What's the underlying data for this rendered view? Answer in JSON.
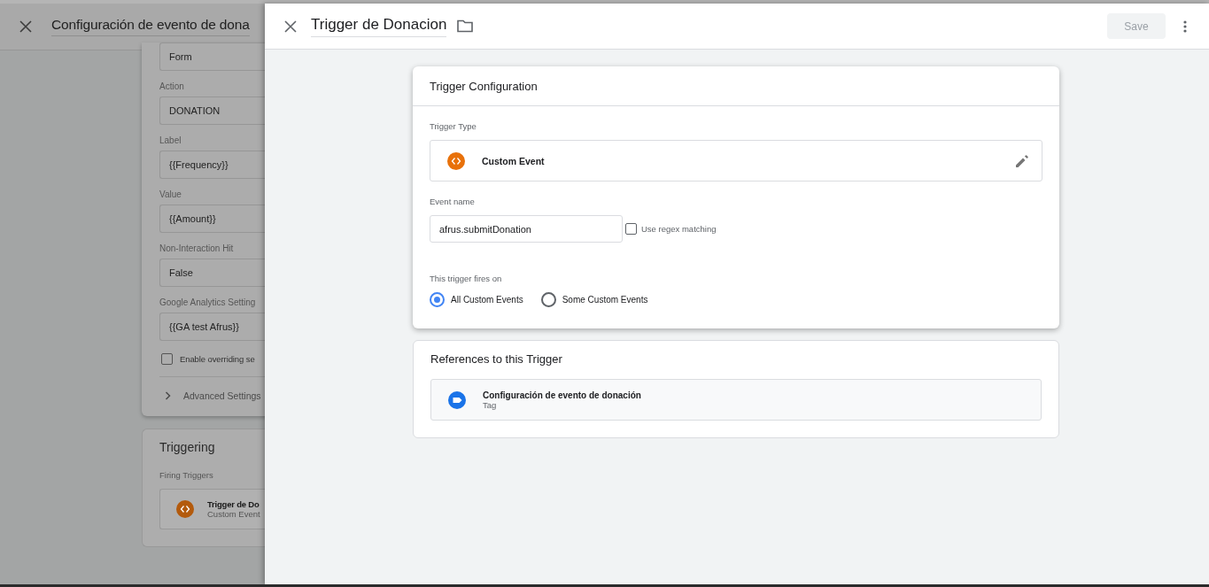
{
  "background_tag": {
    "title": "Configuración de evento de dona",
    "fields": [
      {
        "value": "Form"
      },
      {
        "label": "Action",
        "value": "DONATION"
      },
      {
        "label": "Label",
        "value": "{{Frequency}}"
      },
      {
        "label": "Value",
        "value": "{{Amount}}"
      },
      {
        "label": "Non-Interaction Hit",
        "value": "False"
      },
      {
        "label": "Google Analytics Setting",
        "value": "{{GA test Afrus}}"
      }
    ],
    "override": {
      "label": "Enable overriding se",
      "checked": false
    },
    "advanced": {
      "label": "Advanced Settings",
      "expanded": false
    },
    "triggering": {
      "title": "Triggering",
      "subtitle": "Firing Triggers",
      "items": [
        {
          "name": "Trigger de Do",
          "type": "Custom Event"
        }
      ]
    }
  },
  "trigger_panel": {
    "title": "Trigger de Donacion",
    "save": {
      "label": "Save",
      "disabled": true
    },
    "configuration": {
      "title": "Trigger Configuration",
      "type_label": "Trigger Type",
      "type": "Custom Event",
      "event_name_label": "Event name",
      "event_name": "afrus.submitDonation",
      "regex": {
        "label": "Use regex matching",
        "checked": false
      },
      "fires_on_label": "This trigger fires on",
      "options": [
        {
          "label": "All Custom Events",
          "selected": true
        },
        {
          "label": "Some Custom Events",
          "selected": false
        }
      ]
    },
    "references": {
      "title": "References to this Trigger",
      "items": [
        {
          "name": "Configuración de evento de donación",
          "type": "Tag"
        }
      ]
    }
  }
}
